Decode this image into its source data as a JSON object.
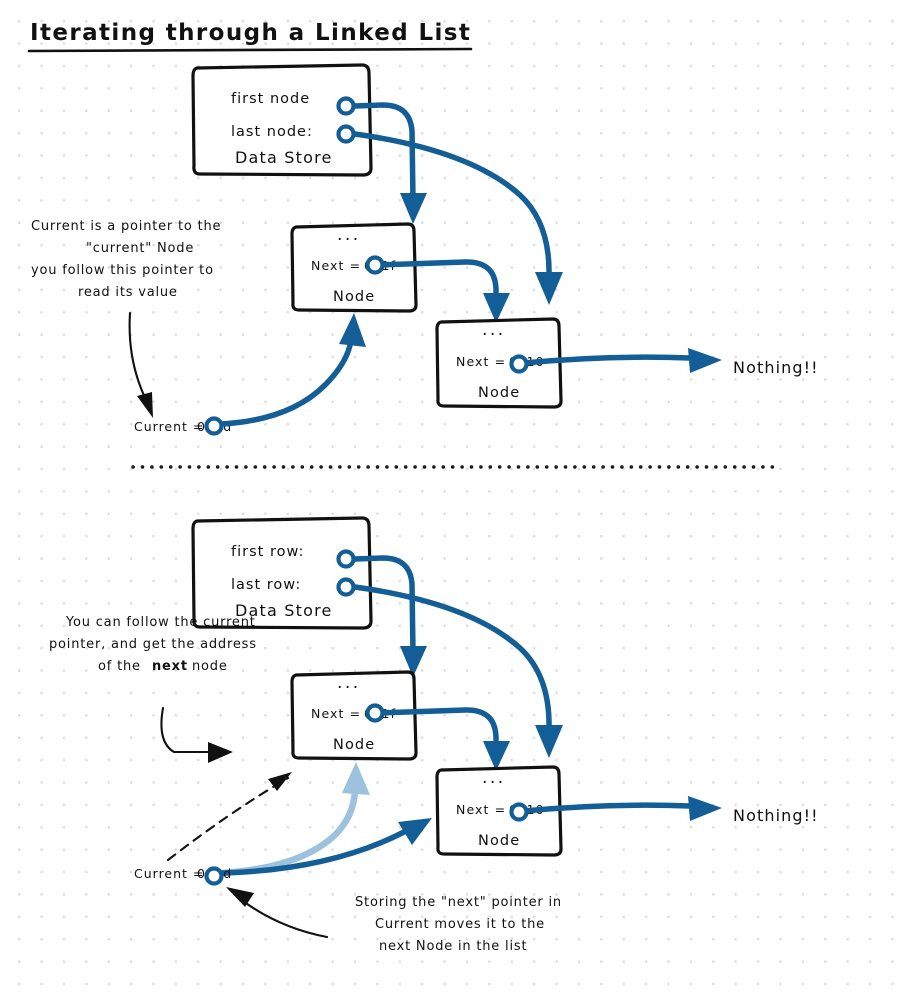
{
  "page": {
    "title": "Iterating through a Linked List",
    "background": "#ffffff",
    "accent_color": "#135e96",
    "faded_accent_color": "#9cc2dd",
    "ink_color": "#111111"
  },
  "sections": [
    {
      "id": "upper",
      "data_store": {
        "name": "data-store-box-upper",
        "rows": [
          "first node",
          "last node:"
        ],
        "title": "Data Store"
      },
      "nodes": [
        {
          "name": "node-box-upper-first",
          "dots": "...",
          "next_label": "Next =",
          "next_value": "0x1f",
          "title": "Node"
        },
        {
          "name": "node-box-upper-second",
          "dots": "...",
          "next_label": "Next =",
          "next_value": "0x10",
          "title": "Node"
        }
      ],
      "terminator": "Nothing!!",
      "current": {
        "label": "Current =",
        "value": "0x3d"
      },
      "annotation": {
        "lines": [
          "Current is a pointer to the",
          "\"current\" Node",
          "you follow this pointer to",
          "read its value"
        ]
      }
    },
    {
      "id": "lower",
      "data_store": {
        "name": "data-store-box-lower",
        "rows": [
          "first row:",
          "last row:"
        ],
        "title": "Data Store"
      },
      "nodes": [
        {
          "name": "node-box-lower-first",
          "dots": "...",
          "next_label": "Next =",
          "next_value": "0x1f",
          "title": "Node"
        },
        {
          "name": "node-box-lower-second",
          "dots": "...",
          "next_label": "Next =",
          "next_value": "0x10",
          "title": "Node"
        }
      ],
      "terminator": "Nothing!!",
      "current": {
        "label": "Current =",
        "value": "0x3d"
      },
      "annotation_top": {
        "line1": "You can follow the current",
        "line2_a": "pointer, and get the address",
        "line3_a": "of the ",
        "line3_bold": "next",
        "line3_b": " node"
      },
      "annotation_bottom": {
        "lines": [
          "Storing the \"next\" pointer in",
          "Current moves it to the",
          "next Node in the list"
        ]
      }
    }
  ]
}
